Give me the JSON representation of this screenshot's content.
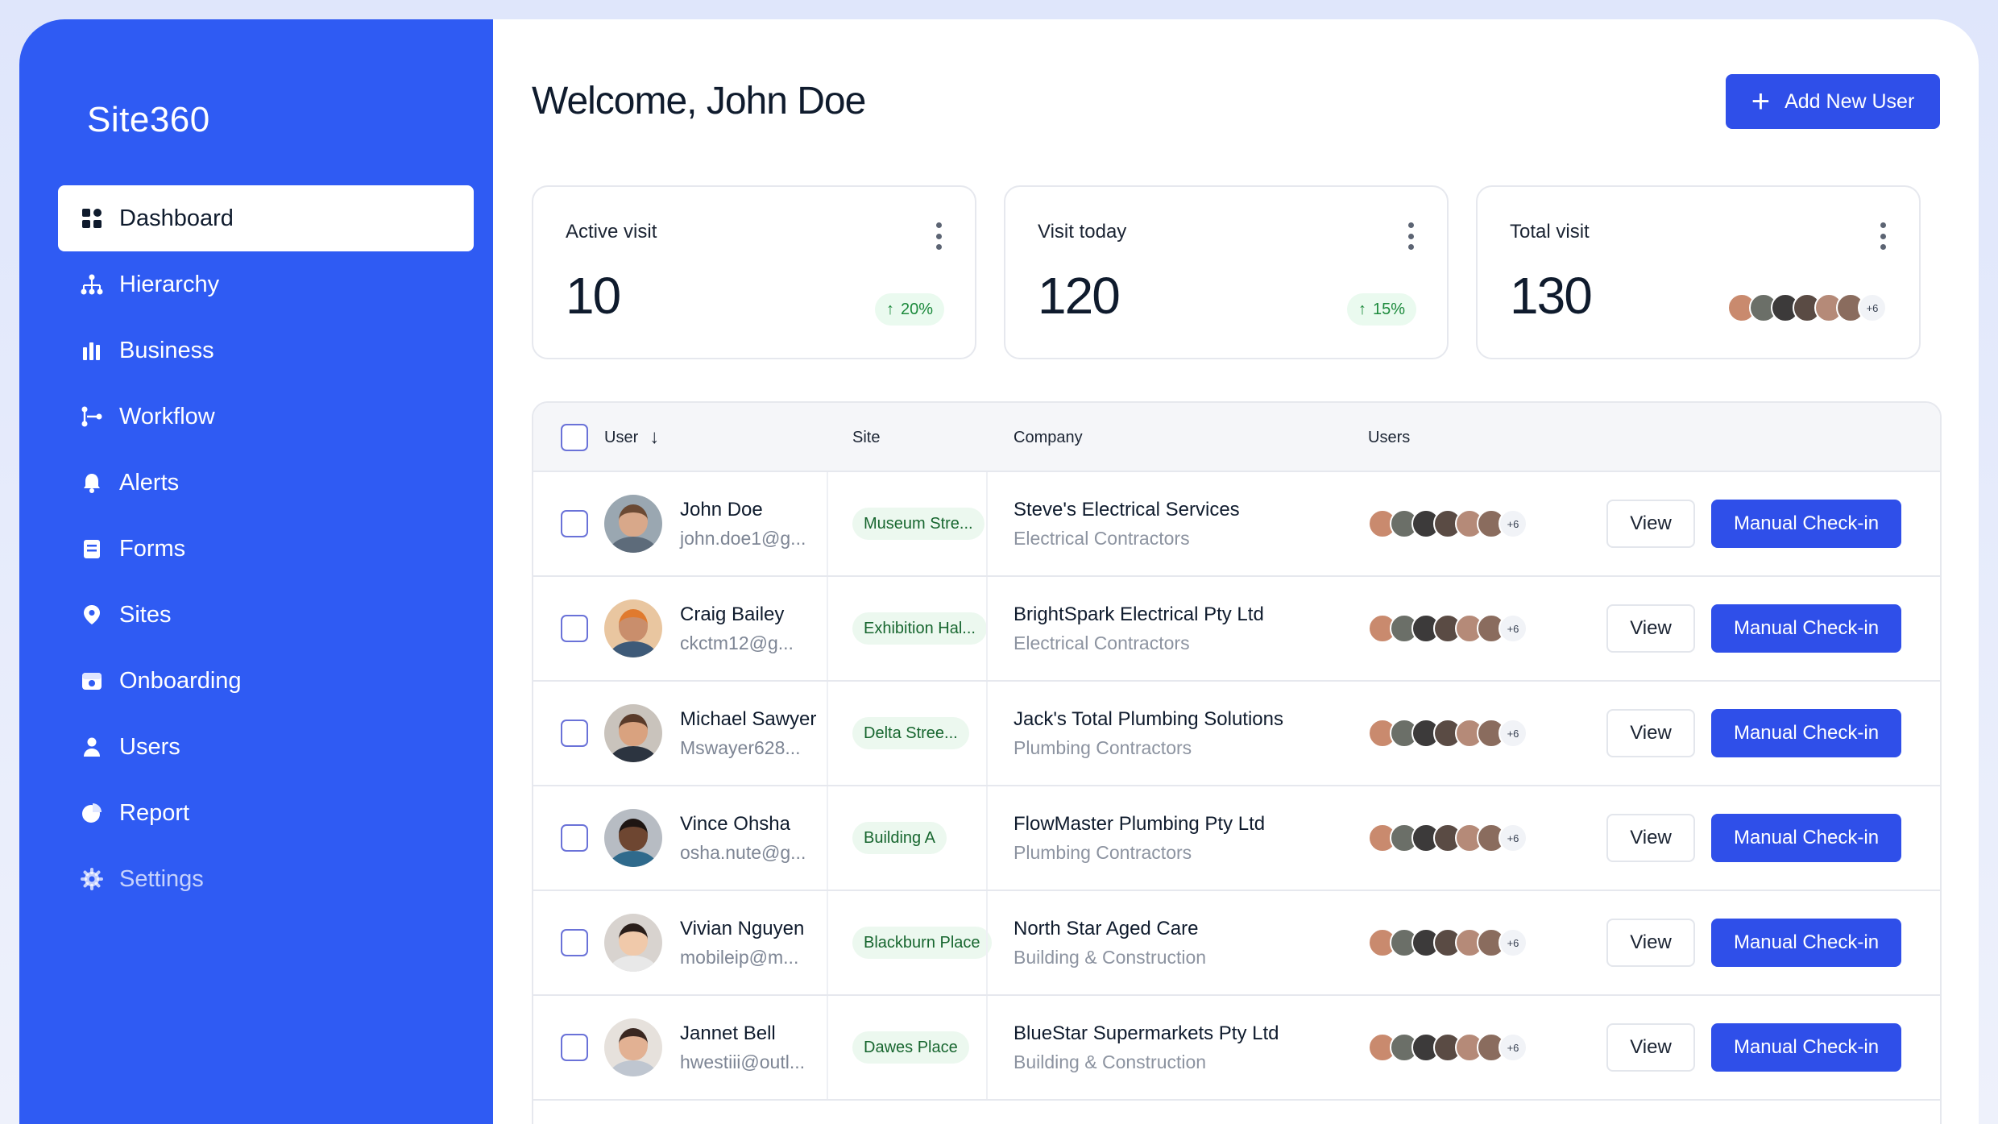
{
  "sidebar": {
    "logo": "Site360",
    "items": [
      {
        "label": "Dashboard",
        "icon": "grid-icon",
        "active": true
      },
      {
        "label": "Hierarchy",
        "icon": "hierarchy-icon"
      },
      {
        "label": "Business",
        "icon": "bar-chart-icon"
      },
      {
        "label": "Workflow",
        "icon": "workflow-icon"
      },
      {
        "label": "Alerts",
        "icon": "bell-icon"
      },
      {
        "label": "Forms",
        "icon": "form-icon"
      },
      {
        "label": "Sites",
        "icon": "location-pin-icon"
      },
      {
        "label": "Onboarding",
        "icon": "onboarding-icon"
      },
      {
        "label": "Users",
        "icon": "user-icon"
      },
      {
        "label": "Report",
        "icon": "pie-chart-icon"
      },
      {
        "label": "Settings",
        "icon": "gear-icon"
      }
    ]
  },
  "header": {
    "welcome": "Welcome, John Doe",
    "add_user_label": "Add New User"
  },
  "stats": [
    {
      "title": "Active visit",
      "value": "10",
      "trend": "20%"
    },
    {
      "title": "Visit today",
      "value": "120",
      "trend": "15%"
    },
    {
      "title": "Total visit",
      "value": "130",
      "more": "+6"
    }
  ],
  "table": {
    "columns": {
      "user": "User",
      "site": "Site",
      "company": "Company",
      "users": "Users"
    },
    "more_count": "+6",
    "view_label": "View",
    "checkin_label": "Manual Check-in",
    "rows": [
      {
        "name": "John Doe",
        "email": "john.doe1@g...",
        "site": "Museum Stre...",
        "company": "Steve's Electrical Services",
        "type": "Electrical Contractors"
      },
      {
        "name": "Craig Bailey",
        "email": "ckctm12@g...",
        "site": "Exhibition Hal...",
        "company": "BrightSpark Electrical Pty Ltd",
        "type": "Electrical Contractors"
      },
      {
        "name": "Michael Sawyer",
        "email": "Mswayer628...",
        "site": "Delta Stree...",
        "company": "Jack's Total Plumbing Solutions",
        "type": "Plumbing Contractors"
      },
      {
        "name": "Vince Ohsha",
        "email": "osha.nute@g...",
        "site": "Building A",
        "company": "FlowMaster Plumbing Pty Ltd",
        "type": "Plumbing Contractors"
      },
      {
        "name": "Vivian Nguyen",
        "email": "mobileip@m...",
        "site": "Blackburn Place",
        "company": "North Star Aged Care",
        "type": "Building & Construction"
      },
      {
        "name": "Jannet Bell",
        "email": "hwestiii@outl...",
        "site": "Dawes Place",
        "company": "BlueStar Supermarkets Pty Ltd",
        "type": "Building & Construction"
      }
    ]
  },
  "colors": {
    "sidebar": "#2f5bf3",
    "primary_button": "#2f4fe9",
    "trend_green": "#1c8a3c",
    "site_pill_bg": "#ecf8ef"
  }
}
